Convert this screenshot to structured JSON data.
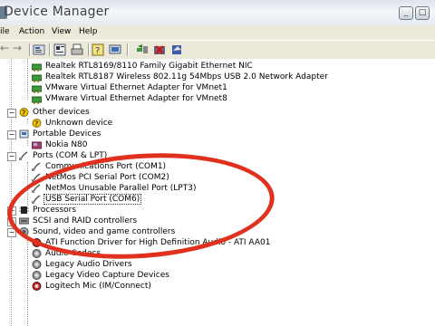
{
  "window": {
    "title": "Device Manager",
    "controls": [
      "_",
      "□"
    ]
  },
  "menu": {
    "items": [
      "ile",
      "Action",
      "View",
      "Help"
    ]
  },
  "toolbar": {
    "back_label": "←",
    "forward_label": "→",
    "icons": [
      "properties-icon",
      "print-icon",
      "help-icon",
      "scan-icon",
      "update-driver-icon",
      "uninstall-icon",
      "disable-icon"
    ]
  },
  "tree": {
    "network_adapters": [
      "Realtek RTL8169/8110 Family Gigabit Ethernet NIC",
      "Realtek RTL8187 Wireless 802.11g 54Mbps USB 2.0 Network Adapter",
      "VMware Virtual Ethernet Adapter for VMnet1",
      "VMware Virtual Ethernet Adapter for VMnet8"
    ],
    "other_devices": {
      "label": "Other devices",
      "children": [
        "Unknown device"
      ]
    },
    "portable_devices": {
      "label": "Portable Devices",
      "children": [
        "Nokia N80"
      ]
    },
    "ports": {
      "label": "Ports (COM & LPT)",
      "children": [
        "Communications Port (COM1)",
        "NetMos PCI Serial Port (COM2)",
        "NetMos Unusable Parallel Port (LPT3)",
        "USB Serial Port (COM6)"
      ]
    },
    "processors": {
      "label": "Processors"
    },
    "scsi": {
      "label": "SCSI and RAID controllers"
    },
    "sound": {
      "label": "Sound, video and game controllers",
      "children": [
        "ATI Function Driver for High Definition Audio - ATI AA01",
        "Audio Codecs",
        "Legacy Audio Drivers",
        "Legacy Video Capture Devices",
        "Logitech Mic (IM/Connect)"
      ]
    }
  },
  "colors": {
    "annotation": "#e0301e",
    "network_icon": "#3a9a3a",
    "warning": "#f2c200"
  }
}
